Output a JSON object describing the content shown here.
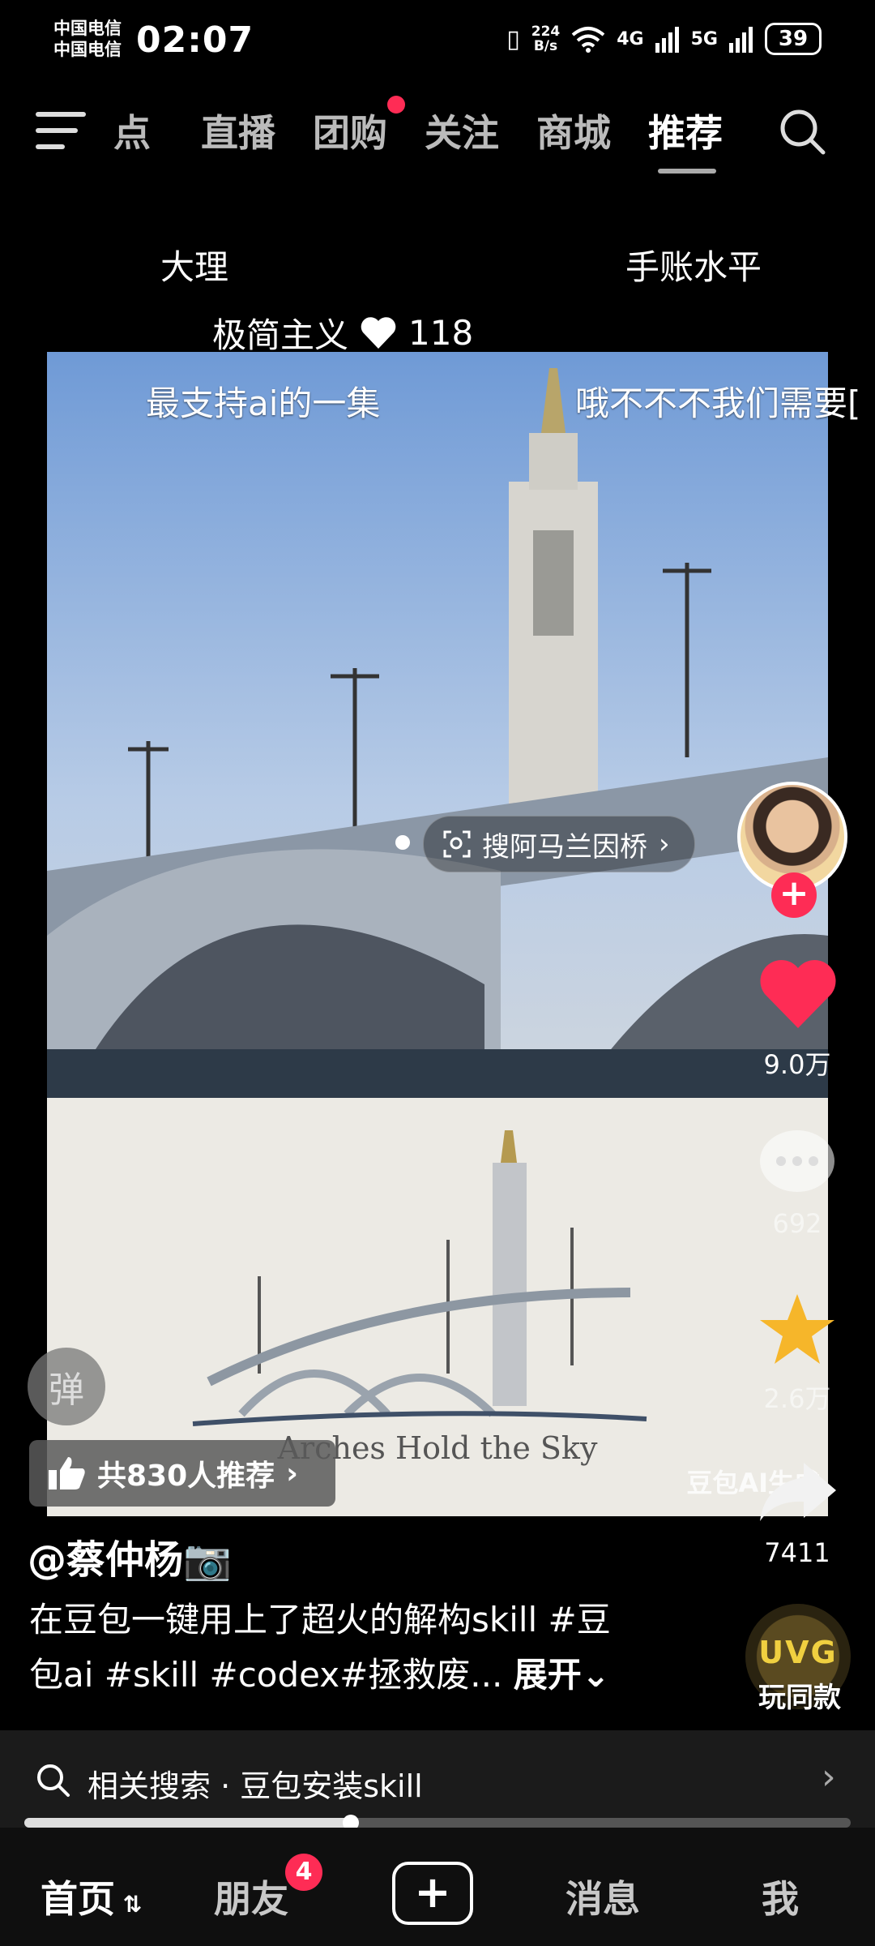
{
  "status_bar": {
    "carrier1": "中国电信",
    "carrier2": "中国电信",
    "time": "02:07",
    "net_speed_value": "224",
    "net_speed_unit": "B/s",
    "network1": "4G",
    "network2": "5G",
    "battery": "39"
  },
  "top_nav": {
    "tabs": [
      "热点",
      "直播",
      "团购",
      "关注",
      "商城",
      "推荐"
    ],
    "partial_tab": "点",
    "active_tab": "推荐"
  },
  "overlay_texts": {
    "left": "大理",
    "right": "手账水平",
    "tag": "极简主义",
    "likes": "118",
    "danmaku1": "最支持ai的一集",
    "danmaku2": "哦不不不我们需要[",
    "search_chip": "搜阿马兰因桥"
  },
  "poster": {
    "title": "Arches Hold the Sky",
    "watermark": "豆包AI生成"
  },
  "right_rail": {
    "likes": "9.0万",
    "comments": "692",
    "favorites": "2.6万",
    "shares": "7411"
  },
  "video_info": {
    "danmaku_button": "弹",
    "recommend": "共830人推荐",
    "author": "@蔡仲杨📷",
    "description_line1": "在豆包一键用上了超火的解构skill #豆",
    "description_line2": "包ai #skill #codex#拯救废...",
    "expand": "展开",
    "same_style": "玩同款",
    "same_style_logo": "UVG"
  },
  "related_search": {
    "label": "相关搜索 · 豆包安装skill"
  },
  "progress": {
    "fraction": 0.395
  },
  "bottom_nav": {
    "home": "首页",
    "friends": "朋友",
    "friends_badge": "4",
    "messages": "消息",
    "me": "我"
  },
  "colors": {
    "accent": "#fe2c55",
    "star": "#f6b62a"
  }
}
